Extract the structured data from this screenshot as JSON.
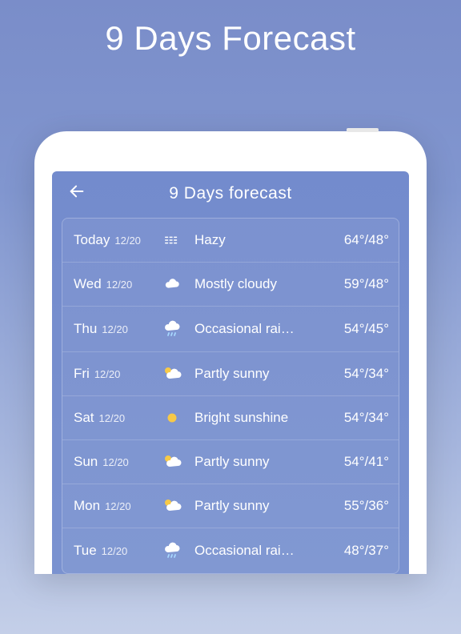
{
  "promo_title": "9 Days Forecast",
  "app_header": {
    "title": "9  Days forecast"
  },
  "forecast": [
    {
      "day": "Today",
      "date": "12/20",
      "icon": "haze",
      "condition": "Hazy",
      "hi": "64°",
      "lo": "48°"
    },
    {
      "day": "Wed",
      "date": "12/20",
      "icon": "cloudy",
      "condition": "Mostly cloudy",
      "hi": "59°",
      "lo": "48°"
    },
    {
      "day": "Thu",
      "date": "12/20",
      "icon": "rain",
      "condition": "Occasional rai…",
      "hi": "54°",
      "lo": "45°"
    },
    {
      "day": "Fri",
      "date": "12/20",
      "icon": "partly",
      "condition": "Partly sunny",
      "hi": "54°",
      "lo": "34°"
    },
    {
      "day": "Sat",
      "date": "12/20",
      "icon": "sunny",
      "condition": "Bright sunshine",
      "hi": "54°",
      "lo": "34°"
    },
    {
      "day": "Sun",
      "date": "12/20",
      "icon": "partly",
      "condition": "Partly sunny",
      "hi": "54°",
      "lo": "41°"
    },
    {
      "day": "Mon",
      "date": "12/20",
      "icon": "partly",
      "condition": "Partly sunny",
      "hi": "55°",
      "lo": "36°"
    },
    {
      "day": "Tue",
      "date": "12/20",
      "icon": "rain",
      "condition": "Occasional rai…",
      "hi": "48°",
      "lo": "37°"
    }
  ]
}
